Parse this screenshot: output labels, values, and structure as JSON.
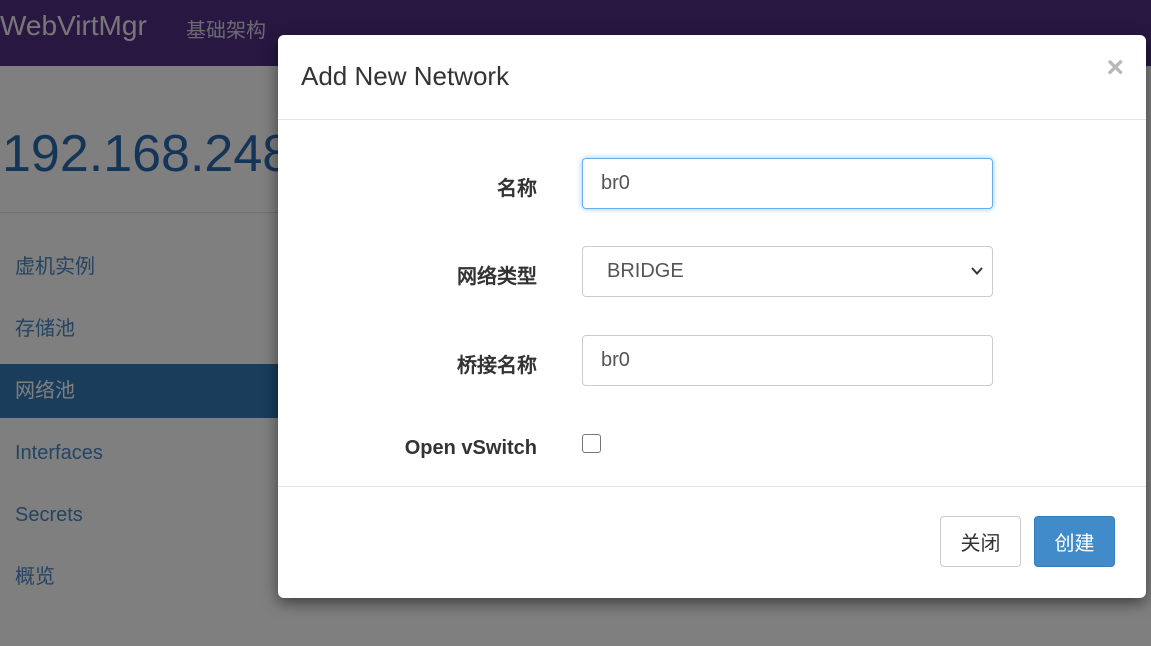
{
  "navbar": {
    "brand": "WebVirtMgr",
    "nav_link": "基础架构"
  },
  "host": {
    "title": "192.168.248"
  },
  "sidebar": {
    "items": [
      {
        "label": "虚机实例"
      },
      {
        "label": "存储池"
      },
      {
        "label": "网络池",
        "active": true
      },
      {
        "label": "Interfaces"
      },
      {
        "label": "Secrets"
      },
      {
        "label": "概览"
      }
    ]
  },
  "modal": {
    "title": "Add New Network",
    "close_symbol": "×",
    "fields": {
      "name_label": "名称",
      "name_value": "br0",
      "type_label": "网络类型",
      "type_value": "BRIDGE",
      "bridge_label": "桥接名称",
      "bridge_value": "br0",
      "ovs_label": "Open vSwitch",
      "ovs_checked": false
    },
    "footer": {
      "close_label": "关闭",
      "create_label": "创建"
    }
  },
  "colors": {
    "navbar_bg": "#4f2e82",
    "primary": "#428bca",
    "sidebar_active": "#337ab7",
    "host_title": "#2a6bb0"
  },
  "icons": {
    "close": "close-icon",
    "select_arrow": "chevron-down-icon",
    "checkbox": "checkbox-icon"
  }
}
